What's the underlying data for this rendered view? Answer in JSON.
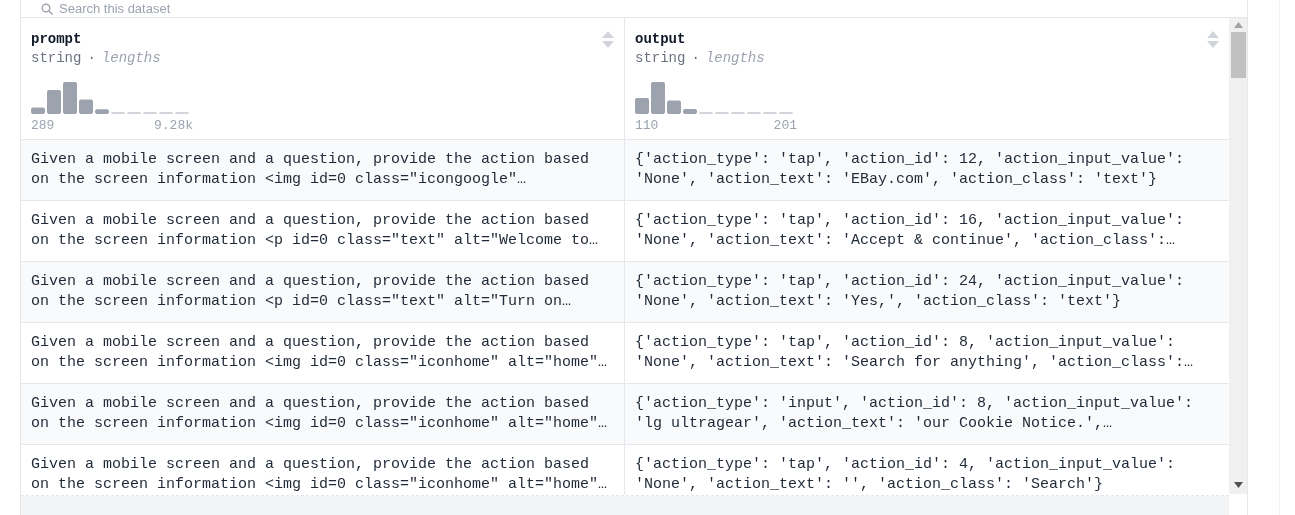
{
  "search": {
    "placeholder": "Search this dataset"
  },
  "columns": [
    {
      "name": "prompt",
      "type": "string",
      "separator": "·",
      "stat": "lengths",
      "min": "289",
      "max": "9.28k"
    },
    {
      "name": "output",
      "type": "string",
      "separator": "·",
      "stat": "lengths",
      "min": "110",
      "max": "201"
    }
  ],
  "rows": [
    [
      "Given a mobile screen and a question, provide the action based on the screen information <img id=0 class=\"icongoogle\"…",
      "{'action_type': 'tap', 'action_id': 12, 'action_input_value': 'None', 'action_text': 'EBay.com', 'action_class': 'text'}"
    ],
    [
      "Given a mobile screen and a question, provide the action based on the screen information <p id=0 class=\"text\" alt=\"Welcome to…",
      "{'action_type': 'tap', 'action_id': 16, 'action_input_value': 'None', 'action_text': 'Accept & continue', 'action_class':…"
    ],
    [
      "Given a mobile screen and a question, provide the action based on the screen information <p id=0 class=\"text\" alt=\"Turn on…",
      "{'action_type': 'tap', 'action_id': 24, 'action_input_value': 'None', 'action_text': 'Yes,', 'action_class': 'text'}"
    ],
    [
      "Given a mobile screen and a question, provide the action based on the screen information <img id=0 class=\"iconhome\" alt=\"home\"…",
      "{'action_type': 'tap', 'action_id': 8, 'action_input_value': 'None', 'action_text': 'Search for anything', 'action_class':…"
    ],
    [
      "Given a mobile screen and a question, provide the action based on the screen information <img id=0 class=\"iconhome\" alt=\"home\"…",
      "{'action_type': 'input', 'action_id': 8, 'action_input_value': 'lg ultragear', 'action_text': 'our Cookie Notice.',…"
    ],
    [
      "Given a mobile screen and a question, provide the action based on the screen information <img id=0 class=\"iconhome\" alt=\"home\"…",
      "{'action_type': 'tap', 'action_id': 4, 'action_input_value': 'None', 'action_text': '', 'action_class': 'Search'}"
    ]
  ]
}
